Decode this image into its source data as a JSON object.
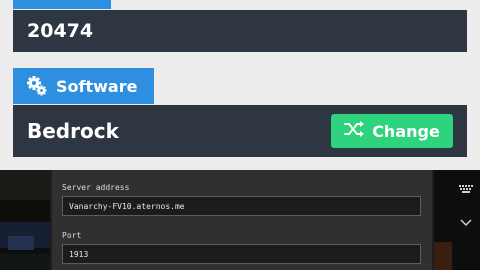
{
  "panel": {
    "port_value": "20474",
    "software_tab_label": "Software",
    "software_value": "Bedrock",
    "change_button_label": "Change"
  },
  "game": {
    "server_address_label": "Server address",
    "server_address_value": "Vanarchy-FV10.aternos.me",
    "port_label": "Port",
    "port_value": "1913"
  },
  "icons": {
    "software": "gears-icon",
    "change": "shuffle-icon",
    "keyboard": "keyboard-icon",
    "collapse": "chevron-down-icon"
  },
  "colors": {
    "accent_blue": "#2e8fe0",
    "dark_bar": "#2d3641",
    "change_green": "#2ed47d",
    "page_bg": "#ececec"
  }
}
